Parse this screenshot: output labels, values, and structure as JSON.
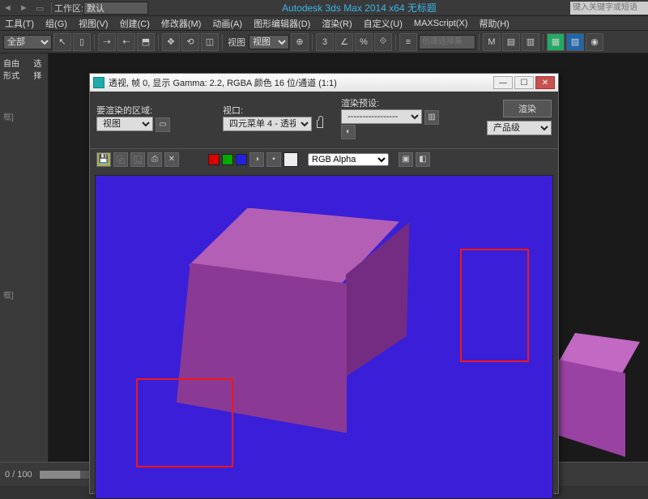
{
  "titlebar": {
    "workspace_label": "工作区:",
    "workspace_value": "默认",
    "app_title": "Autodesk 3ds Max  2014 x64       无标题",
    "search_placeholder": "键入关键字或短语"
  },
  "menubar": [
    "工具(T)",
    "组(G)",
    "视图(V)",
    "创建(C)",
    "修改器(M)",
    "动画(A)",
    "图形编辑器(D)",
    "渲染(R)",
    "自定义(U)",
    "MAXScript(X)",
    "帮助(H)"
  ],
  "toolbar": {
    "scope_value": "全部",
    "view_label": "视图",
    "selection_set_placeholder": "创建选择集"
  },
  "left_panel": {
    "tab1": "自由形式",
    "tab2": "选择",
    "axis1": "框]",
    "axis2": "框]"
  },
  "status": {
    "coord": "0 / 100"
  },
  "render_window": {
    "title": "透视, 帧 0, 显示 Gamma: 2.2, RGBA 颜色 16 位/通道 (1:1)",
    "area_label": "要渲染的区域:",
    "area_value": "视图",
    "viewport_label": "视口:",
    "viewport_value": "四元菜单 4 - 透视",
    "preset_label": "渲染预设:",
    "preset_value": "-----------------",
    "render_btn": "渲染",
    "product_value": "产品级",
    "channel_value": "RGB Alpha"
  }
}
